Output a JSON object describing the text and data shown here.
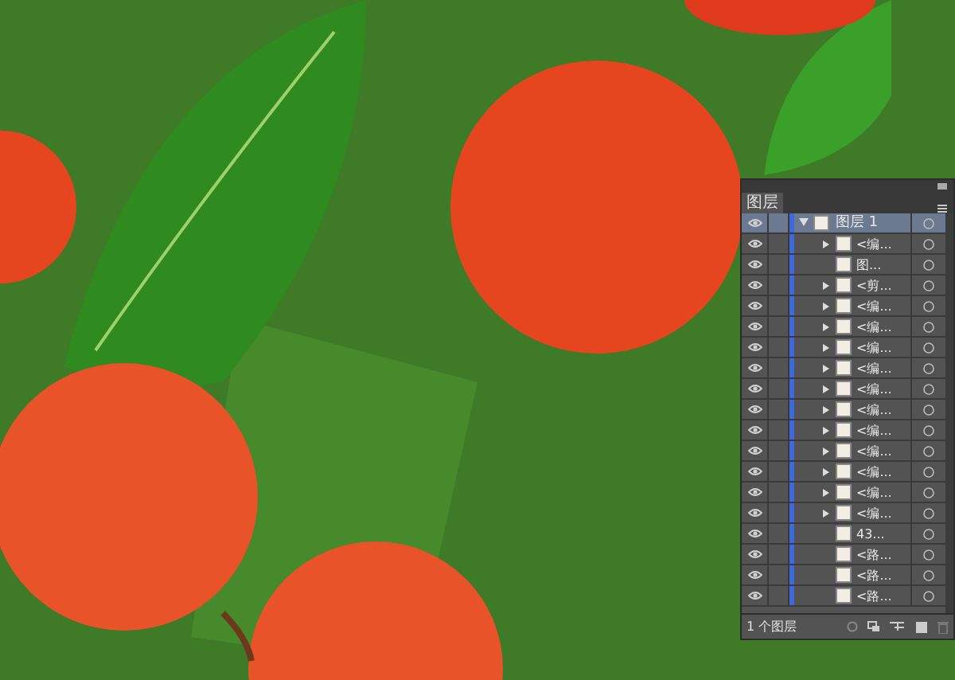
{
  "layers_panel": {
    "tab": "图层",
    "layers": [
      {
        "name": "图层 1",
        "visible": true,
        "selected": true,
        "expanded": true,
        "children": [
          {
            "name": "<编...",
            "visible": true,
            "expandable": true
          },
          {
            "name": "图...",
            "visible": true,
            "expandable": false
          },
          {
            "name": "<剪...",
            "visible": true,
            "expandable": true
          },
          {
            "name": "<编...",
            "visible": true,
            "expandable": true
          },
          {
            "name": "<编...",
            "visible": true,
            "expandable": true
          },
          {
            "name": "<编...",
            "visible": true,
            "expandable": true
          },
          {
            "name": "<编...",
            "visible": true,
            "expandable": true
          },
          {
            "name": "<编...",
            "visible": true,
            "expandable": true
          },
          {
            "name": "<编...",
            "visible": true,
            "expandable": true
          },
          {
            "name": "<编...",
            "visible": true,
            "expandable": true
          },
          {
            "name": "<编...",
            "visible": true,
            "expandable": true
          },
          {
            "name": "<编...",
            "visible": true,
            "expandable": true
          },
          {
            "name": "<编...",
            "visible": true,
            "expandable": true
          },
          {
            "name": "<编...",
            "visible": true,
            "expandable": true
          },
          {
            "name": "43...",
            "visible": true,
            "expandable": false
          },
          {
            "name": "<路...",
            "visible": true,
            "expandable": false
          },
          {
            "name": "<路...",
            "visible": true,
            "expandable": false
          },
          {
            "name": "<路...",
            "visible": true,
            "expandable": false
          }
        ]
      }
    ],
    "footer": {
      "count": "1 个图层"
    }
  }
}
